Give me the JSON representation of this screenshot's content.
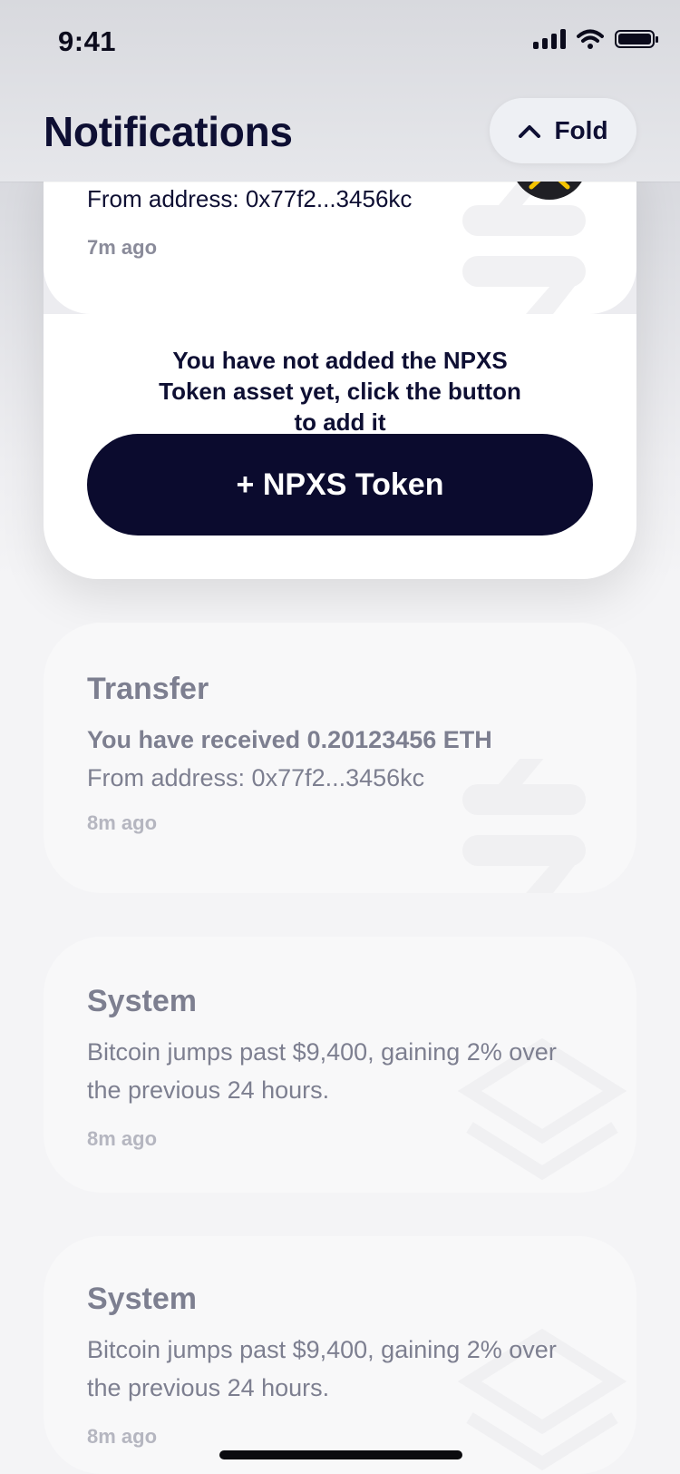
{
  "status_bar": {
    "time": "9:41"
  },
  "header": {
    "title": "Notifications",
    "fold_label": "Fold"
  },
  "expanded": {
    "from_line": "From address: 0x77f2...3456kc",
    "time": "7m ago",
    "prompt": "You have not added the NPXS Token asset yet, click the button to add it",
    "button_label": "+ NPXS Token"
  },
  "notifications": [
    {
      "title": "Transfer",
      "line1": "You have received 0.20123456 ETH",
      "line2": "From address: 0x77f2...3456kc",
      "time": "8m ago"
    },
    {
      "title": "System",
      "text": "Bitcoin jumps past $9,400, gaining 2% over the previous 24 hours.",
      "time": "8m ago"
    },
    {
      "title": "System",
      "text": "Bitcoin jumps past $9,400, gaining 2% over the previous 24 hours.",
      "time": "8m ago"
    }
  ],
  "colors": {
    "accent": "#0b0b2e",
    "coin": "#f5c400",
    "text": "#0e0f33"
  }
}
